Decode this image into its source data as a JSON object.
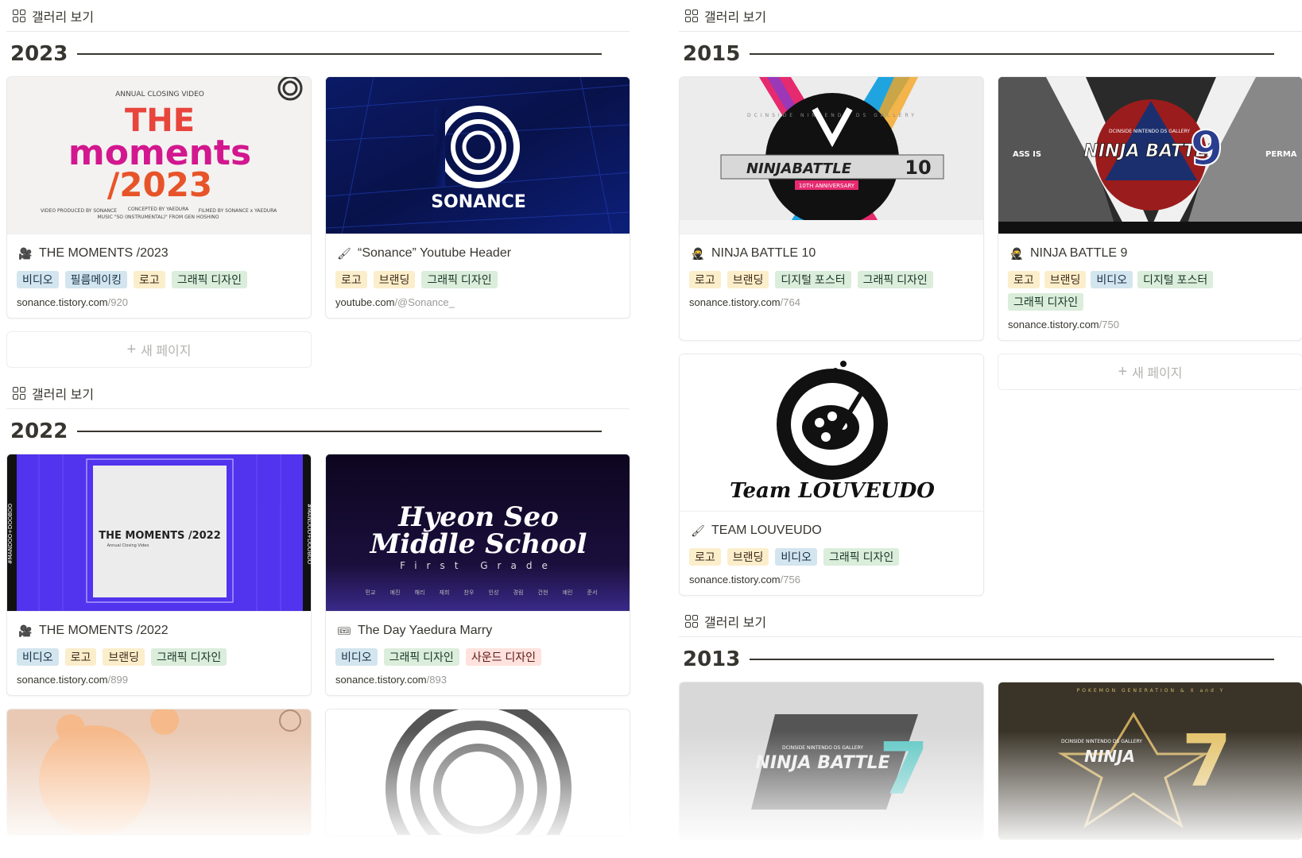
{
  "view_label": "갤러리 보기",
  "new_page_label": "새 페이지",
  "tag_colors": {
    "blue": "#d3e5ef",
    "orange": "#fadec9",
    "yellow": "#fbeecb",
    "green": "#dbeddb",
    "red": "#ffe2dd"
  },
  "left": {
    "y2023": {
      "year": "2023",
      "cards": [
        {
          "icon": "film-camera-icon",
          "title": "THE MOMENTS /2023",
          "cover": {
            "small_top": "ANNUAL CLOSING VIDEO",
            "line1": "THE",
            "line2": "moments",
            "line3": "/2023",
            "credits_left": "VIDEO PRODUCED BY SONANCE",
            "credits_mid": "CONCEPTED BY YAEDURA",
            "credits_right": "FILMED BY SONANCE x YAEDURA",
            "credits_music": "MUSIC \"SO (INSTRUMENTAL)\" FROM GEN HOSHINO"
          },
          "tags": [
            {
              "label": "비디오",
              "color": "blue"
            },
            {
              "label": "필름메이킹",
              "color": "blue"
            },
            {
              "label": "로고",
              "color": "orange"
            },
            {
              "label": "그래픽 디자인",
              "color": "green"
            }
          ],
          "url_domain": "sonance.tistory.com",
          "url_path": "/920"
        },
        {
          "icon": "paintbrush-icon",
          "title": "“Sonance” Youtube Header",
          "cover": {
            "logo_text": "SONANCE"
          },
          "tags": [
            {
              "label": "로고",
              "color": "orange"
            },
            {
              "label": "브랜딩",
              "color": "orange"
            },
            {
              "label": "그래픽 디자인",
              "color": "green"
            }
          ],
          "url_domain": "youtube.com",
          "url_path": "/@Sonance_"
        }
      ]
    },
    "y2022": {
      "year": "2022",
      "cards": [
        {
          "icon": "film-camera-icon",
          "title": "THE MOMENTS /2022",
          "cover": {
            "main": "THE MOMENTS /2022",
            "sub": "Annual Closing Video",
            "side_text": "#MANDOO+DOOBOO"
          },
          "tags": [
            {
              "label": "비디오",
              "color": "blue"
            },
            {
              "label": "로고",
              "color": "orange"
            },
            {
              "label": "브랜딩",
              "color": "orange"
            },
            {
              "label": "그래픽 디자인",
              "color": "green"
            }
          ],
          "url_domain": "sonance.tistory.com",
          "url_path": "/899"
        },
        {
          "icon": "ticket-icon",
          "title": "The Day Yaedura Marry",
          "cover": {
            "line1": "Hyeon Seo",
            "line2": "Middle School",
            "line3": "First Grade",
            "names": [
              "민교",
              "예진",
              "해리",
              "재희",
              "찬우",
              "인성",
              "경림",
              "건현",
              "예린",
              "준서"
            ]
          },
          "tags": [
            {
              "label": "비디오",
              "color": "blue"
            },
            {
              "label": "그래픽 디자인",
              "color": "green"
            },
            {
              "label": "사운드 디자인",
              "color": "red"
            }
          ],
          "url_domain": "sonance.tistory.com",
          "url_path": "/893"
        }
      ]
    }
  },
  "right": {
    "y2015": {
      "year": "2015",
      "cards": [
        {
          "icon": "ninja-icon",
          "title": "NINJA BATTLE 10",
          "cover": {
            "logo": "NINJABATTLE",
            "number": "10",
            "ribbon": "10TH ANNIVERSARY",
            "arc": "DCINSIDE NINTENDO DS GALLERY"
          },
          "tags": [
            {
              "label": "로고",
              "color": "orange"
            },
            {
              "label": "브랜딩",
              "color": "orange"
            },
            {
              "label": "디지털 포스터",
              "color": "green"
            },
            {
              "label": "그래픽 디자인",
              "color": "green"
            }
          ],
          "url_domain": "sonance.tistory.com",
          "url_path": "/764"
        },
        {
          "icon": "ninja-icon",
          "title": "NINJA BATTLE 9",
          "cover": {
            "logo": "NINJA BATTLE",
            "number": "9",
            "left_text": "ASS IS",
            "right_text": "PERMA",
            "gallery": "DCINSIDE NINTENDO DS GALLERY"
          },
          "tags": [
            {
              "label": "로고",
              "color": "orange"
            },
            {
              "label": "브랜딩",
              "color": "orange"
            },
            {
              "label": "비디오",
              "color": "blue"
            },
            {
              "label": "디지털 포스터",
              "color": "green"
            },
            {
              "label": "그래픽 디자인",
              "color": "green"
            }
          ],
          "url_domain": "sonance.tistory.com",
          "url_path": "/750"
        },
        {
          "icon": "paintbrush-icon",
          "title": "TEAM LOUVEUDO",
          "cover": {
            "script": "Team LOUVEUDO"
          },
          "tags": [
            {
              "label": "로고",
              "color": "orange"
            },
            {
              "label": "브랜딩",
              "color": "orange"
            },
            {
              "label": "비디오",
              "color": "blue"
            },
            {
              "label": "그래픽 디자인",
              "color": "green"
            }
          ],
          "url_domain": "sonance.tistory.com",
          "url_path": "/756"
        }
      ]
    },
    "y2013": {
      "year": "2013",
      "cards": [
        {
          "cover": {
            "logo": "NINJA BATTLE",
            "gallery": "DCINSIDE NINTENDO DS GALLERY",
            "number": "7"
          }
        },
        {
          "cover": {
            "logo": "NINJA",
            "gallery": "DCINSIDE NINTENDO DS GALLERY",
            "number": "7",
            "top": "POKEMON GENERATION & X and Y"
          }
        }
      ]
    }
  }
}
